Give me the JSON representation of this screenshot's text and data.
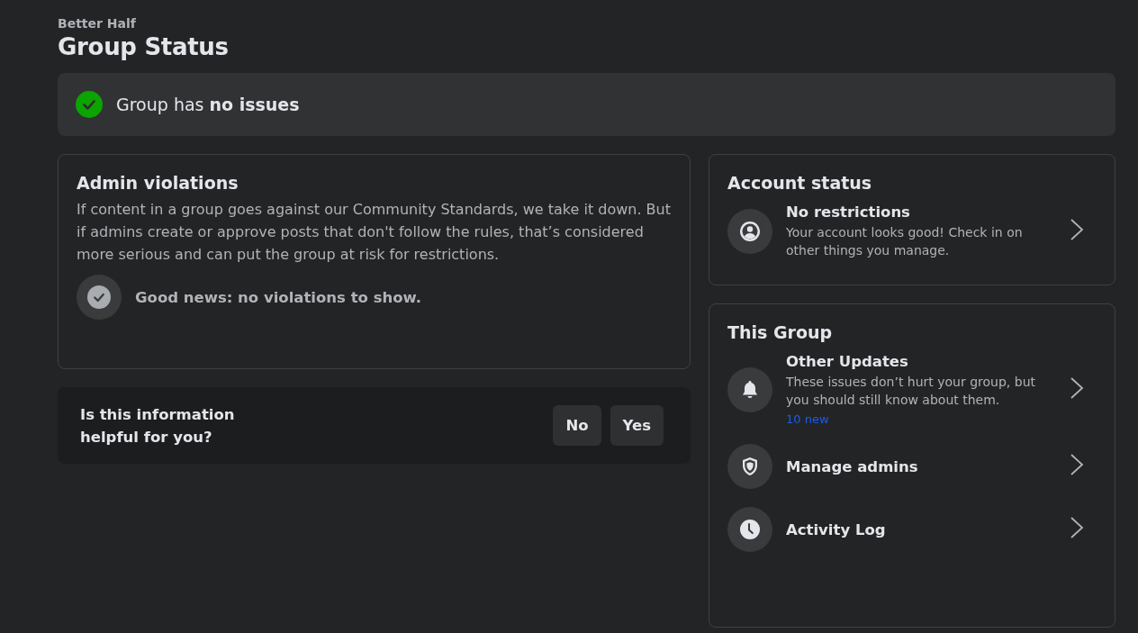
{
  "header": {
    "group_name": "Better Half",
    "title": "Group Status"
  },
  "status_banner": {
    "text": "Group has **no issues**",
    "ok": true
  },
  "admin_violations": {
    "title": "Admin violations",
    "description": "If content in a group goes against our Community Standards, we take it down. But if admins create or approve posts that don't follow the rules, that’s considered more serious and can put the group at risk for restrictions.",
    "message": "Good news: no violations to show."
  },
  "feedback": {
    "question": "Is this information helpful for you?",
    "buttons": [
      "No",
      "Yes"
    ]
  },
  "account_status": {
    "title": "Account status",
    "items": [
      {
        "kind": "person",
        "title": "No restrictions",
        "description": "Your account looks good! Check in on other things you manage."
      }
    ]
  },
  "this_group": {
    "title": "This Group",
    "items": [
      {
        "kind": "bell",
        "title": "Other Updates",
        "description": "These issues don’t hurt your group, but you should still know about them.",
        "badge": "10 new"
      },
      {
        "kind": "shield",
        "title": "Manage admins"
      },
      {
        "kind": "clock",
        "title": "Activity Log"
      }
    ]
  }
}
